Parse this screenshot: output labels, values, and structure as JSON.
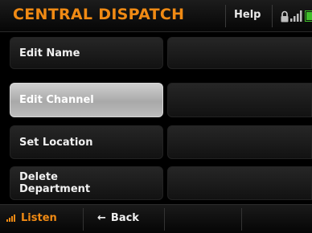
{
  "header": {
    "title": "CENTRAL DISPATCH",
    "help_label": "Help",
    "status_icons": [
      "lock-icon",
      "signal-icon",
      "battery-icon"
    ]
  },
  "menu": {
    "items": [
      {
        "label": "Edit Name",
        "selected": false
      },
      {
        "label": "Edit Channel",
        "selected": true
      },
      {
        "label": "Set Location",
        "selected": false
      },
      {
        "label": "Delete\nDepartment",
        "selected": false
      }
    ]
  },
  "footer": {
    "listen_label": "Listen",
    "back_label": "Back",
    "back_icon": "left-arrow-icon"
  },
  "colors": {
    "accent": "#f08a14",
    "background": "#000000",
    "selected": "#bcbcbc",
    "battery": "#3fbf2a"
  }
}
